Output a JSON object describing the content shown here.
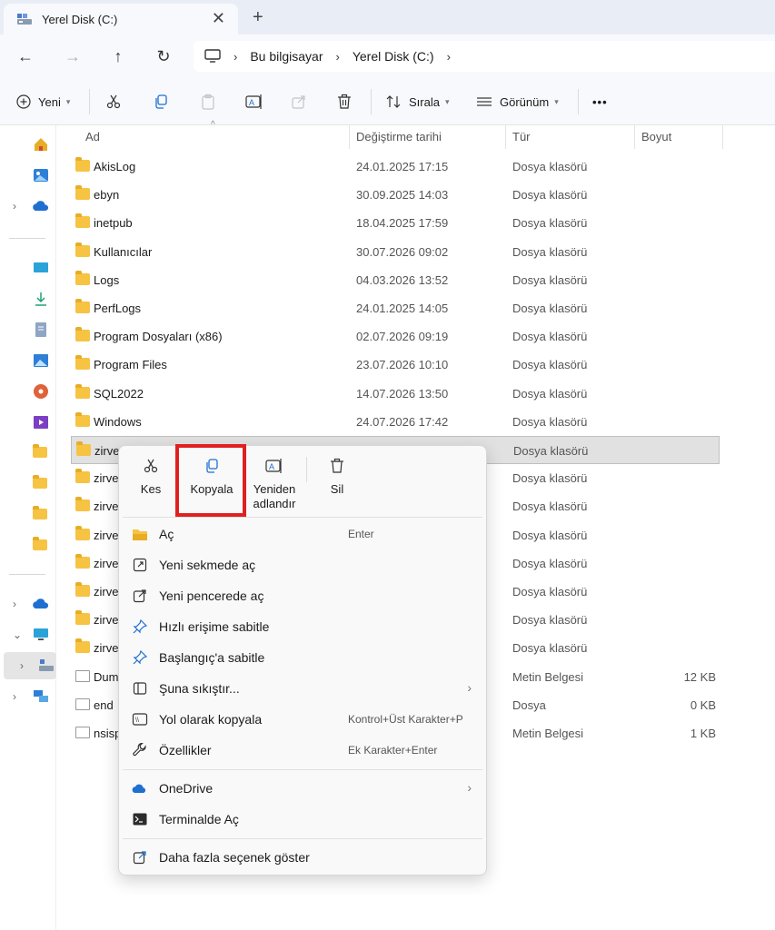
{
  "tab": {
    "title": "Yerel Disk (C:)",
    "close": "✕",
    "new_tab": "+"
  },
  "nav": {
    "back": "←",
    "forward": "→",
    "up": "↑",
    "refresh": "↻"
  },
  "breadcrumb": [
    "Bu bilgisayar",
    "Yerel Disk (C:)"
  ],
  "breadcrumb_sep": "›",
  "commands": {
    "new": "Yeni",
    "sort": "Sırala",
    "view": "Görünüm",
    "more": "•••"
  },
  "columns": {
    "name": "Ad",
    "date": "Değiştirme tarihi",
    "type": "Tür",
    "size": "Boyut"
  },
  "files": [
    {
      "name": "AkisLog",
      "date": "24.01.2025 17:15",
      "type": "Dosya klasörü",
      "size": "",
      "kind": "folder"
    },
    {
      "name": "ebyn",
      "date": "30.09.2025 14:03",
      "type": "Dosya klasörü",
      "size": "",
      "kind": "folder"
    },
    {
      "name": "inetpub",
      "date": "18.04.2025 17:59",
      "type": "Dosya klasörü",
      "size": "",
      "kind": "folder"
    },
    {
      "name": "Kullanıcılar",
      "date": "30.07.2026 09:02",
      "type": "Dosya klasörü",
      "size": "",
      "kind": "folder"
    },
    {
      "name": "Logs",
      "date": "04.03.2026 13:52",
      "type": "Dosya klasörü",
      "size": "",
      "kind": "folder"
    },
    {
      "name": "PerfLogs",
      "date": "24.01.2025 14:05",
      "type": "Dosya klasörü",
      "size": "",
      "kind": "folder"
    },
    {
      "name": "Program Dosyaları (x86)",
      "date": "02.07.2026 09:19",
      "type": "Dosya klasörü",
      "size": "",
      "kind": "folder"
    },
    {
      "name": "Program Files",
      "date": "23.07.2026 10:10",
      "type": "Dosya klasörü",
      "size": "",
      "kind": "folder"
    },
    {
      "name": "SQL2022",
      "date": "14.07.2026 13:50",
      "type": "Dosya klasörü",
      "size": "",
      "kind": "folder"
    },
    {
      "name": "Windows",
      "date": "24.07.2026 17:42",
      "type": "Dosya klasörü",
      "size": "",
      "kind": "folder"
    },
    {
      "name": "zirve",
      "date": "",
      "type": "Dosya klasörü",
      "size": "",
      "kind": "folder",
      "selected": true
    },
    {
      "name": "zirve",
      "date": "",
      "type": "Dosya klasörü",
      "size": "",
      "kind": "folder"
    },
    {
      "name": "zirve",
      "date": "",
      "type": "Dosya klasörü",
      "size": "",
      "kind": "folder"
    },
    {
      "name": "zirve",
      "date": "",
      "type": "Dosya klasörü",
      "size": "",
      "kind": "folder"
    },
    {
      "name": "zirve",
      "date": "",
      "type": "Dosya klasörü",
      "size": "",
      "kind": "folder"
    },
    {
      "name": "zirve",
      "date": "",
      "type": "Dosya klasörü",
      "size": "",
      "kind": "folder"
    },
    {
      "name": "zirve",
      "date": "",
      "type": "Dosya klasörü",
      "size": "",
      "kind": "folder"
    },
    {
      "name": "zirve",
      "date": "",
      "type": "Dosya klasörü",
      "size": "",
      "kind": "folder"
    },
    {
      "name": "Dum",
      "date": "",
      "type": "Metin Belgesi",
      "size": "12 KB",
      "kind": "file"
    },
    {
      "name": "end",
      "date": "",
      "type": "Dosya",
      "size": "0 KB",
      "kind": "file"
    },
    {
      "name": "nsisp",
      "date": "",
      "type": "Metin Belgesi",
      "size": "1 KB",
      "kind": "file"
    }
  ],
  "context_menu": {
    "quick_actions": [
      {
        "label": "Kes",
        "icon": "scissors-icon"
      },
      {
        "label": "Kopyala",
        "icon": "copy-icon"
      },
      {
        "label": "Yeniden adlandır",
        "icon": "rename-icon"
      },
      {
        "label": "Sil",
        "icon": "trash-icon"
      }
    ],
    "items": [
      {
        "label": "Aç",
        "shortcut": "Enter",
        "icon": "folder-open-icon"
      },
      {
        "label": "Yeni sekmede aç",
        "shortcut": "",
        "icon": "new-tab-icon"
      },
      {
        "label": "Yeni pencerede aç",
        "shortcut": "",
        "icon": "new-window-icon"
      },
      {
        "label": "Hızlı erişime sabitle",
        "shortcut": "",
        "icon": "pin-icon"
      },
      {
        "label": "Başlangıç'a sabitle",
        "shortcut": "",
        "icon": "pin-start-icon"
      },
      {
        "label": "Şuna sıkıştır...",
        "shortcut": "",
        "icon": "archive-icon",
        "submenu": true
      },
      {
        "label": "Yol olarak kopyala",
        "shortcut": "Kontrol+Üst Karakter+P",
        "icon": "copy-path-icon"
      },
      {
        "label": "Özellikler",
        "shortcut": "Ek Karakter+Enter",
        "icon": "wrench-icon"
      },
      {
        "label": "OneDrive",
        "shortcut": "",
        "icon": "onedrive-icon",
        "submenu": true
      },
      {
        "label": "Terminalde Aç",
        "shortcut": "",
        "icon": "terminal-icon"
      },
      {
        "label": "Daha fazla seçenek göster",
        "shortcut": "",
        "icon": "more-options-icon"
      }
    ],
    "chevron": "›"
  },
  "colors": {
    "accent": "#1f6fd1",
    "highlight": "#e02020",
    "folder": "#f6c343"
  }
}
